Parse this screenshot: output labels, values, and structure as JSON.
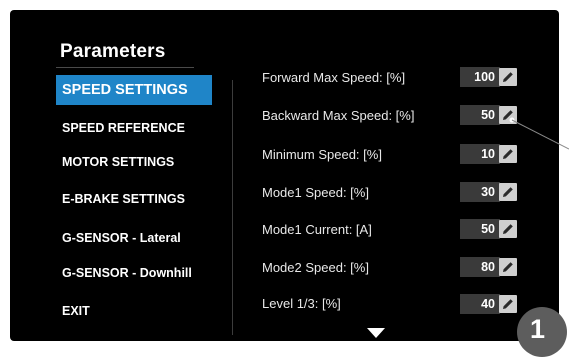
{
  "screen": {
    "title": "Parameters",
    "menu": [
      {
        "label": "SPEED SETTINGS",
        "active": true
      },
      {
        "label": "SPEED REFERENCE",
        "active": false
      },
      {
        "label": "MOTOR SETTINGS",
        "active": false
      },
      {
        "label": "E-BRAKE SETTINGS",
        "active": false
      },
      {
        "label": "G-SENSOR - Lateral",
        "active": false
      },
      {
        "label": "G-SENSOR - Downhill",
        "active": false
      },
      {
        "label": "EXIT",
        "active": false
      }
    ],
    "parameters": [
      {
        "label": "Forward Max Speed: [%]",
        "value": "100"
      },
      {
        "label": "Backward Max Speed: [%]",
        "value": "50"
      },
      {
        "label": "Minimum Speed: [%]",
        "value": "10"
      },
      {
        "label": "Mode1 Speed: [%]",
        "value": "30"
      },
      {
        "label": "Mode1 Current: [A]",
        "value": "50"
      },
      {
        "label": "Mode2 Speed: [%]",
        "value": "80"
      },
      {
        "label": "Level 1/3: [%]",
        "value": "40"
      }
    ],
    "scroll_icon": "triangle-down-icon",
    "edit_icon": "pencil-icon"
  },
  "callout": {
    "number": "1"
  },
  "colors": {
    "background": "#000000",
    "accent": "#1f85c8",
    "value_box": "#3a3a3a",
    "edit_button": "#cfcfcf",
    "badge": "#5d5d5d"
  }
}
